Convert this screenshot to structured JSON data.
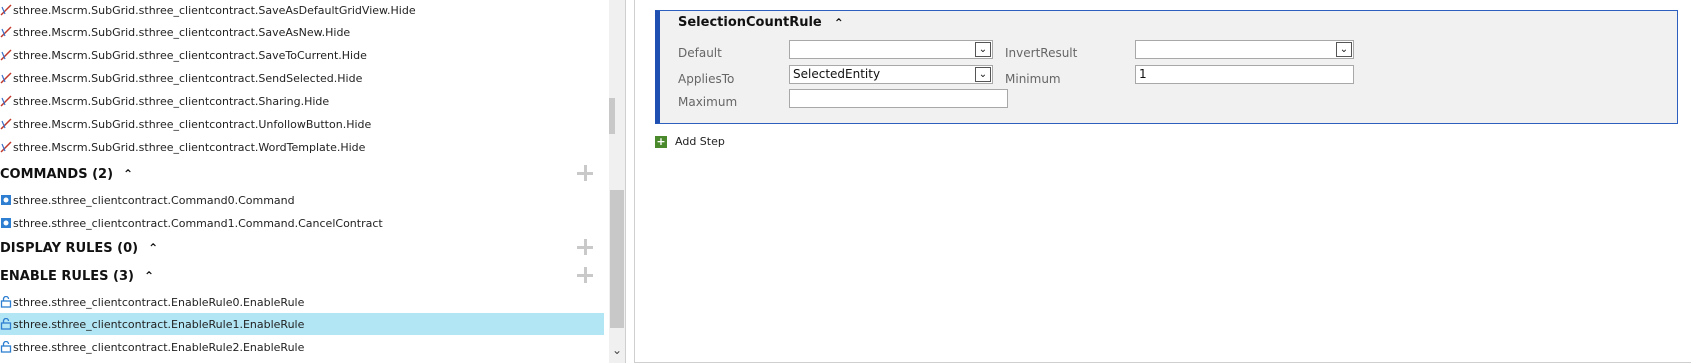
{
  "tree": {
    "hide_rules": [
      "sthree.Mscrm.SubGrid.sthree_clientcontract.SaveAsDefaultGridView.Hide",
      "sthree.Mscrm.SubGrid.sthree_clientcontract.SaveAsNew.Hide",
      "sthree.Mscrm.SubGrid.sthree_clientcontract.SaveToCurrent.Hide",
      "sthree.Mscrm.SubGrid.sthree_clientcontract.SendSelected.Hide",
      "sthree.Mscrm.SubGrid.sthree_clientcontract.Sharing.Hide",
      "sthree.Mscrm.SubGrid.sthree_clientcontract.UnfollowButton.Hide",
      "sthree.Mscrm.SubGrid.sthree_clientcontract.WordTemplate.Hide"
    ],
    "commands_header": "COMMANDS (2)",
    "commands": [
      "sthree.sthree_clientcontract.Command0.Command",
      "sthree.sthree_clientcontract.Command1.Command.CancelContract"
    ],
    "display_rules_header": "DISPLAY RULES (0)",
    "enable_rules_header": "ENABLE RULES (3)",
    "enable_rules": [
      "sthree.sthree_clientcontract.EnableRule0.EnableRule",
      "sthree.sthree_clientcontract.EnableRule1.EnableRule",
      "sthree.sthree_clientcontract.EnableRule2.EnableRule"
    ],
    "selected_enable_rule_index": 1
  },
  "icons": {
    "hide_rule": "hidden-rule-icon",
    "command": "command-icon",
    "enable_rule": "enable-rule-icon",
    "collapse": "chevron-up-icon",
    "add": "plus-icon",
    "scroll_down": "chevron-down-icon"
  },
  "rule_card": {
    "title": "SelectionCountRule",
    "default_label": "Default",
    "default_value": "",
    "invert_result_label": "InvertResult",
    "invert_result_value": "",
    "applies_to_label": "AppliesTo",
    "applies_to_value": "SelectedEntity",
    "minimum_label": "Minimum",
    "minimum_value": "1",
    "maximum_label": "Maximum",
    "maximum_value": ""
  },
  "add_step_label": "Add Step",
  "colors": {
    "selection": "#b3e6f4",
    "card_border": "#1f4fb0",
    "add_icon": "#4a8a2c"
  }
}
